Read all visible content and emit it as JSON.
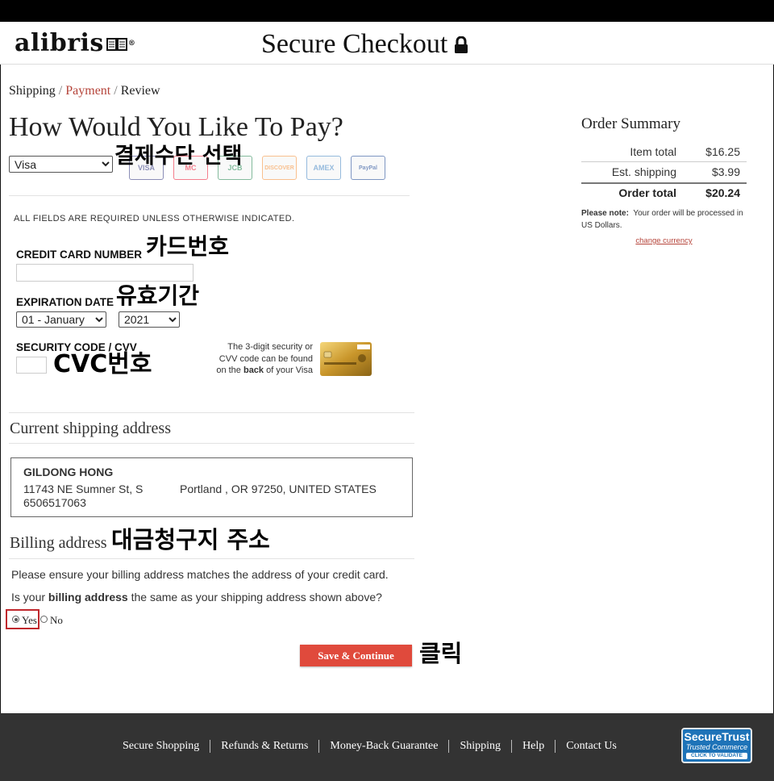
{
  "header": {
    "logo": "alibris",
    "title": "Secure Checkout"
  },
  "breadcrumb": {
    "step1": "Shipping",
    "step2": "Payment",
    "step3": "Review",
    "separator": "/"
  },
  "payment": {
    "heading": "How Would You Like To Pay?",
    "method_selected": "Visa",
    "accepted_cards": [
      {
        "name": "visa-card-icon",
        "label": "VISA",
        "color": "#1a1f71"
      },
      {
        "name": "mastercard-icon",
        "label": "MC",
        "color": "#eb001b"
      },
      {
        "name": "jcb-card-icon",
        "label": "JCB",
        "color": "#0b7a3e"
      },
      {
        "name": "discover-card-icon",
        "label": "DISCOVER",
        "color": "#f58220"
      },
      {
        "name": "amex-card-icon",
        "label": "AMEX",
        "color": "#2e77bc"
      },
      {
        "name": "paypal-icon",
        "label": "PayPal",
        "color": "#003087"
      }
    ],
    "required_note": "ALL FIELDS ARE REQUIRED UNLESS OTHERWISE INDICATED.",
    "card_number_label": "CREDIT CARD NUMBER",
    "card_number_value": "",
    "expiration_label": "EXPIRATION DATE",
    "exp_month": "01 - January",
    "exp_year": "2021",
    "security_label": "SECURITY CODE / CVV",
    "security_value": "",
    "cvv_note": {
      "line1": "The 3-digit security or",
      "line2": "CVV code can be found",
      "line3_pre": "on the ",
      "line3_bold": "back",
      "line3_post": " of your Visa"
    }
  },
  "shipping": {
    "heading": "Current shipping address",
    "name": "GILDONG HONG",
    "street": "11743 NE Sumner St, S",
    "city_line": "Portland , OR 97250, UNITED STATES",
    "phone": "6506517063"
  },
  "billing": {
    "heading": "Billing address",
    "note": "Please ensure your billing address matches the address of your credit card.",
    "question_pre": "Is your ",
    "question_bold": "billing address",
    "question_post": " the same as your shipping address shown above?",
    "yes_label": "Yes",
    "no_label": "No",
    "selected": "Yes"
  },
  "actions": {
    "save_label": "Save & Continue"
  },
  "annotations": {
    "method": "결제수단 선택",
    "card_number": "카드번호",
    "expiration": "유효기간",
    "cvc": "CVC번호",
    "billing": "대금청구지 주소",
    "click": "클릭"
  },
  "order_summary": {
    "title": "Order Summary",
    "item_total_label": "Item total",
    "item_total_value": "$16.25",
    "shipping_label": "Est. shipping",
    "shipping_value": "$3.99",
    "order_total_label": "Order total",
    "order_total_value": "$20.24",
    "note_bold": "Please note:",
    "note_text": "Your order will be processed in US Dollars.",
    "change_currency": "change currency"
  },
  "footer": {
    "links": [
      "Secure Shopping",
      "Refunds & Returns",
      "Money-Back Guarantee",
      "Shipping",
      "Help",
      "Contact Us"
    ],
    "badge_line1": "SecureTrust",
    "badge_line2": "Trusted Commerce",
    "badge_line3": "CLICK TO VALIDATE"
  },
  "colors": {
    "accent": "#b5443a",
    "button": "#e04a3c",
    "footer": "#333333",
    "highlight": "#c0282d"
  }
}
